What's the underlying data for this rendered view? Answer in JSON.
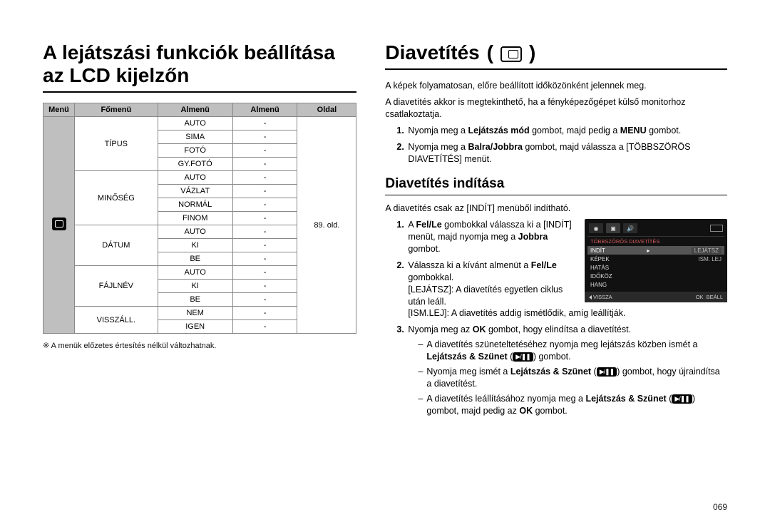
{
  "page_number": "069",
  "left": {
    "heading": "A lejátszási funkciók beállítása az LCD kijelzőn",
    "table": {
      "headers": [
        "Menü",
        "Főmenü",
        "Almenü",
        "Almenü",
        "Oldal"
      ],
      "page_ref": "89. old.",
      "groups": [
        {
          "main": "TÍPUS",
          "subs": [
            "AUTO",
            "SIMA",
            "FOTÓ",
            "GY.FOTÓ"
          ]
        },
        {
          "main": "MINŐSÉG",
          "subs": [
            "AUTO",
            "VÁZLAT",
            "NORMÁL",
            "FINOM"
          ]
        },
        {
          "main": "DÁTUM",
          "subs": [
            "AUTO",
            "KI",
            "BE"
          ]
        },
        {
          "main": "FÁJLNÉV",
          "subs": [
            "AUTO",
            "KI",
            "BE"
          ]
        },
        {
          "main": "VISSZÁLL.",
          "subs": [
            "NEM",
            "IGEN"
          ]
        }
      ]
    },
    "footnote_mark": "※",
    "footnote": "A menük előzetes értesítés nélkül változhatnak."
  },
  "right": {
    "heading": "Diavetítés",
    "heading_icon": "slideshow-icon",
    "intro1": "A képek folyamatosan, előre beállított időközönként jelennek meg.",
    "intro2": "A diavetítés akkor is megtekinthető, ha a fényképezőgépet külső monitorhoz csatlakoztatja.",
    "steps_top": [
      {
        "pre": "Nyomja meg a ",
        "b1": "Lejátszás mód",
        "mid": " gombot, majd pedig a ",
        "b2": "MENU",
        "post": " gombot."
      },
      {
        "pre": "Nyomja meg a ",
        "b1": "Balra/Jobbra",
        "mid": " gombot, majd válassza a [TÖBBSZÖRÖS DIAVETÍTÉS] menüt.",
        "b2": "",
        "post": ""
      }
    ],
    "h2": "Diavetítés indítása",
    "sub_intro": "A diavetítés csak az [INDÍT] menüből indítható.",
    "steps_bottom": {
      "s1": {
        "pre": "A ",
        "b1": "Fel/Le",
        "mid1": " gombokkal válassza ki a [INDÍT] menüt, majd nyomja meg a ",
        "b2": "Jobbra",
        "post": " gombot."
      },
      "s2": {
        "pre": "Válassza ki a kívánt almenüt a ",
        "b1": "Fel/Le",
        "post": " gombokkal.",
        "lines": [
          "[LEJÁTSZ]: A diavetítés egyetlen ciklus után leáll.",
          "[ISM.LEJ]: A diavetítés addig ismétlődik, amíg leállítják."
        ]
      },
      "s3": {
        "pre": "Nyomja meg az ",
        "b1": "OK",
        "post": " gombot, hogy elindítsa a diavetítést.",
        "bullets": [
          {
            "pre": "A diavetítés szüneteltetéséhez nyomja meg lejátszás közben ismét a ",
            "b": "Lejátszás & Szünet",
            "mid": " (",
            "post": ") gombot."
          },
          {
            "pre": "Nyomja meg ismét a ",
            "b": "Lejátszás & Szünet",
            "mid": " (",
            "post": ") gombot, hogy újraindítsa a diavetítést."
          },
          {
            "pre": "A diavetítés leállításához nyomja meg a ",
            "b": "Lejátszás & Szünet",
            "mid": " (",
            "post2_pre": ") gombot, majd pedig az ",
            "b2": "OK",
            "post2": " gombot."
          }
        ]
      }
    },
    "lcd": {
      "title": "TÖBBSZÖRÖS DIAVETÍTÉS",
      "rows": [
        {
          "l": "INDÍT",
          "r": "LEJÁTSZ",
          "hl": true
        },
        {
          "l": "KÉPEK",
          "r": "ISM. LEJ"
        },
        {
          "l": "HATÁS",
          "r": ""
        },
        {
          "l": "IDŐKÖZ",
          "r": ""
        },
        {
          "l": "HANG",
          "r": ""
        }
      ],
      "foot_back": "VISSZA",
      "foot_ok": "OK",
      "foot_set": "BEÁLL"
    }
  }
}
